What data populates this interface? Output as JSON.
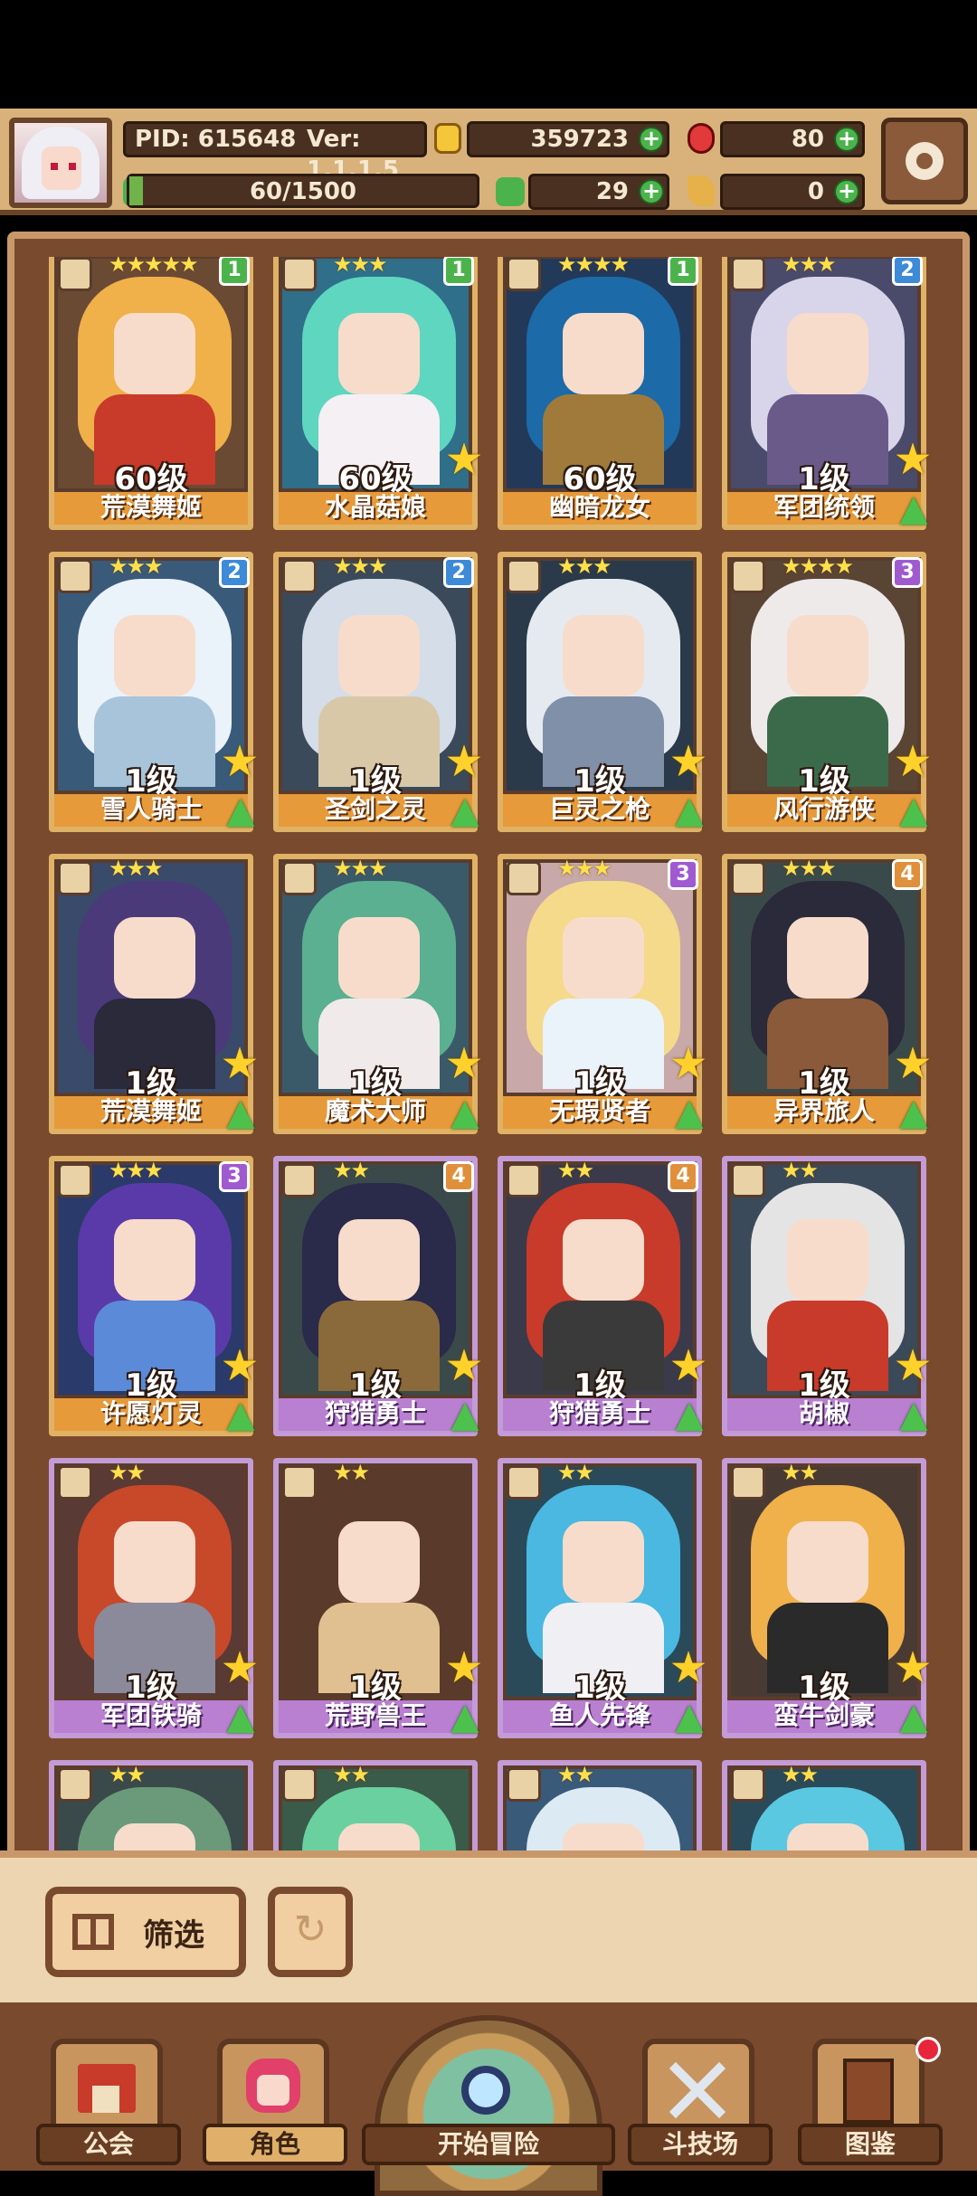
{
  "header": {
    "pid": "PID: 615648",
    "version": "Ver: 1.1.1.5",
    "gold": "359723",
    "ruby": "80",
    "exp": "60/1500",
    "exp_progress": 0.04,
    "clover": "29",
    "pepper": "0"
  },
  "cards": [
    {
      "level": "60级",
      "name": "荒漠舞姬",
      "stars": "★★★★★",
      "badge": "1",
      "frame": "gold",
      "badge_color": "#4cb34c",
      "hair": "#f0b04a",
      "body": "#c83a2a",
      "bg": "#6b4a34",
      "star_up": false,
      "arrow_up": false
    },
    {
      "level": "60级",
      "name": "水晶菇娘",
      "stars": "★★★",
      "badge": "1",
      "frame": "gold",
      "badge_color": "#4cb34c",
      "hair": "#5fd6c0",
      "body": "#f4f0f4",
      "bg": "#2f6f8a",
      "star_up": true,
      "arrow_up": false
    },
    {
      "level": "60级",
      "name": "幽暗龙女",
      "stars": "★★★★",
      "badge": "1",
      "frame": "gold",
      "badge_color": "#4cb34c",
      "hair": "#1c6aa8",
      "body": "#a07a3a",
      "bg": "#23395a",
      "star_up": false,
      "arrow_up": false
    },
    {
      "level": "1级",
      "name": "军团统领",
      "stars": "★★★",
      "badge": "2",
      "frame": "gold",
      "badge_color": "#3c8ad8",
      "hair": "#d8d4ea",
      "body": "#6a5a8a",
      "bg": "#4a4a6a",
      "star_up": true,
      "arrow_up": true
    },
    {
      "level": "1级",
      "name": "雪人骑士",
      "stars": "★★★",
      "badge": "2",
      "frame": "gold",
      "badge_color": "#3c8ad8",
      "hair": "#eaf2fa",
      "body": "#a8c4da",
      "bg": "#3a5a7a",
      "star_up": true,
      "arrow_up": true
    },
    {
      "level": "1级",
      "name": "圣剑之灵",
      "stars": "★★★",
      "badge": "2",
      "frame": "gold",
      "badge_color": "#3c8ad8",
      "hair": "#d4dde8",
      "body": "#d8c8a8",
      "bg": "#3a4a5a",
      "star_up": true,
      "arrow_up": true
    },
    {
      "level": "1级",
      "name": "巨灵之枪",
      "stars": "★★★",
      "badge": "",
      "frame": "gold",
      "badge_color": "#3c8ad8",
      "hair": "#e4eaf0",
      "body": "#8090a8",
      "bg": "#2a3a4a",
      "star_up": true,
      "arrow_up": true
    },
    {
      "level": "1级",
      "name": "风行游侠",
      "stars": "★★★★",
      "badge": "3",
      "frame": "gold",
      "badge_color": "#a05ad0",
      "hair": "#eeeaea",
      "body": "#3a6a4a",
      "bg": "#5a4434",
      "star_up": true,
      "arrow_up": true
    },
    {
      "level": "1级",
      "name": "荒漠舞姬",
      "stars": "★★★",
      "badge": "",
      "frame": "gold",
      "badge_color": "#3c8ad8",
      "hair": "#4a3a7a",
      "body": "#2a2a3a",
      "bg": "#3a4a6a",
      "star_up": true,
      "arrow_up": true
    },
    {
      "level": "1级",
      "name": "魔术大师",
      "stars": "★★★",
      "badge": "",
      "frame": "gold",
      "badge_color": "#3c8ad8",
      "hair": "#5ab090",
      "body": "#f0eaea",
      "bg": "#3a5a6a",
      "star_up": true,
      "arrow_up": true
    },
    {
      "level": "1级",
      "name": "无瑕贤者",
      "stars": "★★★",
      "badge": "3",
      "frame": "gold",
      "badge_color": "#a05ad0",
      "hair": "#f4da8a",
      "body": "#eaf2fa",
      "bg": "#c8a8a8",
      "star_up": true,
      "arrow_up": true
    },
    {
      "level": "1级",
      "name": "异界旅人",
      "stars": "★★★",
      "badge": "4",
      "frame": "gold",
      "badge_color": "#e0903a",
      "hair": "#2a2a3a",
      "body": "#8a5a3a",
      "bg": "#3a4a4a",
      "star_up": true,
      "arrow_up": true
    },
    {
      "level": "1级",
      "name": "许愿灯灵",
      "stars": "★★★",
      "badge": "3",
      "frame": "gold",
      "badge_color": "#a05ad0",
      "hair": "#5a3aa8",
      "body": "#5a8ad8",
      "bg": "#2a3a6a",
      "star_up": true,
      "arrow_up": true
    },
    {
      "level": "1级",
      "name": "狩猎勇士",
      "stars": "★★",
      "badge": "4",
      "frame": "purple",
      "badge_color": "#e0903a",
      "hair": "#2a2a4a",
      "body": "#8a6a3a",
      "bg": "#3a4a4a",
      "star_up": true,
      "arrow_up": true
    },
    {
      "level": "1级",
      "name": "狩猎勇士",
      "stars": "★★",
      "badge": "4",
      "frame": "purple",
      "badge_color": "#e0903a",
      "hair": "#c83a2a",
      "body": "#3a3a3a",
      "bg": "#3a3a4a",
      "star_up": true,
      "arrow_up": true
    },
    {
      "level": "1级",
      "name": "胡椒",
      "stars": "★★",
      "badge": "",
      "frame": "purple",
      "badge_color": "#3c8ad8",
      "hair": "#e4e4e4",
      "body": "#c83a2a",
      "bg": "#3a4a5a",
      "star_up": true,
      "arrow_up": true
    },
    {
      "level": "1级",
      "name": "军团铁骑",
      "stars": "★★",
      "badge": "",
      "frame": "purple",
      "badge_color": "#3c8ad8",
      "hair": "#c8482a",
      "body": "#8a8a9a",
      "bg": "#5a3a34",
      "star_up": true,
      "arrow_up": true
    },
    {
      "level": "1级",
      "name": "荒野兽王",
      "stars": "★★",
      "badge": "",
      "frame": "purple",
      "badge_color": "#3c8ad8",
      "hair": "#5a3a2a",
      "body": "#e0c090",
      "bg": "#5a3a2a",
      "star_up": true,
      "arrow_up": true
    },
    {
      "level": "1级",
      "name": "鱼人先锋",
      "stars": "★★",
      "badge": "",
      "frame": "purple",
      "badge_color": "#3c8ad8",
      "hair": "#4ab8e0",
      "body": "#f0f0f4",
      "bg": "#2a4a5a",
      "star_up": true,
      "arrow_up": true
    },
    {
      "level": "1级",
      "name": "蛮牛剑豪",
      "stars": "★★",
      "badge": "",
      "frame": "purple",
      "badge_color": "#3c8ad8",
      "hair": "#f0b04a",
      "body": "#2a2a2a",
      "bg": "#4a3a34",
      "star_up": true,
      "arrow_up": true
    },
    {
      "level": "",
      "name": "",
      "stars": "★★",
      "badge": "",
      "frame": "purple",
      "badge_color": "#3c8ad8",
      "hair": "#6a9a7a",
      "body": "#4a6a5a",
      "bg": "#3a4a4a",
      "star_up": false,
      "arrow_up": false
    },
    {
      "level": "",
      "name": "",
      "stars": "★★",
      "badge": "",
      "frame": "purple",
      "badge_color": "#3c8ad8",
      "hair": "#6ad0a0",
      "body": "#4a8a7a",
      "bg": "#3a5a4a",
      "star_up": false,
      "arrow_up": false
    },
    {
      "level": "",
      "name": "",
      "stars": "★★",
      "badge": "",
      "frame": "purple",
      "badge_color": "#3c8ad8",
      "hair": "#dceaf4",
      "body": "#a8c4da",
      "bg": "#3a5a7a",
      "star_up": false,
      "arrow_up": false
    },
    {
      "level": "",
      "name": "",
      "stars": "★★",
      "badge": "",
      "frame": "purple",
      "badge_color": "#3c8ad8",
      "hair": "#5ac8e0",
      "body": "#3a8aa8",
      "bg": "#2a4a5a",
      "star_up": false,
      "arrow_up": false
    }
  ],
  "controls": {
    "filter_label": "筛选",
    "reset_icon": "refresh-icon"
  },
  "nav": {
    "guild": "公会",
    "character": "角色",
    "adventure": "开始冒险",
    "arena": "斗技场",
    "codex": "图鉴"
  }
}
